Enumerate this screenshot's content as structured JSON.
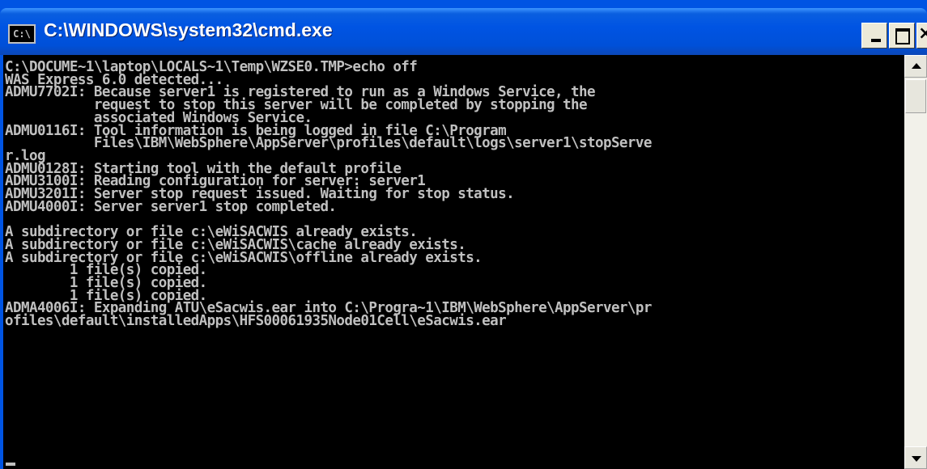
{
  "window": {
    "title": "C:\\WINDOWS\\system32\\cmd.exe",
    "icon_text": "C:\\",
    "controls": {
      "close_glyph": "×"
    }
  },
  "console": {
    "lines": [
      "C:\\DOCUME~1\\laptop\\LOCALS~1\\Temp\\WZSE0.TMP>echo off",
      "WAS Express 6.0 detected...",
      "ADMU7702I: Because server1 is registered to run as a Windows Service, the",
      "           request to stop this server will be completed by stopping the",
      "           associated Windows Service.",
      "ADMU0116I: Tool information is being logged in file C:\\Program",
      "           Files\\IBM\\WebSphere\\AppServer\\profiles\\default\\logs\\server1\\stopServe",
      "r.log",
      "ADMU0128I: Starting tool with the default profile",
      "ADMU3100I: Reading configuration for server: server1",
      "ADMU3201I: Server stop request issued. Waiting for stop status.",
      "ADMU4000I: Server server1 stop completed.",
      "",
      "A subdirectory or file c:\\eWiSACWIS already exists.",
      "A subdirectory or file c:\\eWiSACWIS\\cache already exists.",
      "A subdirectory or file c:\\eWiSACWIS\\offline already exists.",
      "        1 file(s) copied.",
      "        1 file(s) copied.",
      "        1 file(s) copied.",
      "ADMA4006I: Expanding ATU\\eSacwis.ear into C:\\Progra~1\\IBM\\WebSphere\\AppServer\\pr",
      "ofiles\\default\\installedApps\\HFS00061935Node01Cell\\eSacwis.ear"
    ]
  },
  "colors": {
    "titlebar": "#0054e3",
    "console_bg": "#000000",
    "console_text": "#c0c0c0"
  }
}
